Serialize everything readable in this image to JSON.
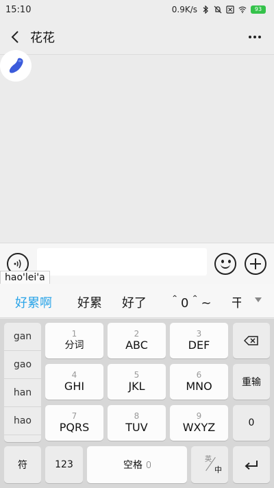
{
  "status_bar": {
    "time": "15:10",
    "network_speed": "0.9K/s",
    "battery": "93",
    "icons": [
      "bluetooth-icon",
      "mute-icon",
      "sim-icon",
      "wifi-icon",
      "battery-icon"
    ]
  },
  "nav": {
    "title": "花花",
    "back_icon": "chevron-left-icon",
    "more_icon": "more-dots-icon"
  },
  "chat": {
    "avatar_icon": "blue-shape-avatar",
    "accent_color": "#3b5bdb"
  },
  "input_bar": {
    "voice_icon": "voice-icon",
    "input_value": "",
    "emoji_icon": "emoji-icon",
    "plus_icon": "plus-icon"
  },
  "ime": {
    "composing_text": "hao'lei'a",
    "candidates": [
      "好累啊",
      "好累",
      "好了",
      "＾0＾~",
      "干"
    ],
    "highlight_color": "#2aa4e8",
    "pinyin_options": [
      "gan",
      "gao",
      "han",
      "hao"
    ],
    "keys": {
      "k1": {
        "num": "1",
        "letters": "分词"
      },
      "k2": {
        "num": "2",
        "letters": "ABC"
      },
      "k3": {
        "num": "3",
        "letters": "DEF"
      },
      "k4": {
        "num": "4",
        "letters": "GHI"
      },
      "k5": {
        "num": "5",
        "letters": "JKL"
      },
      "k6": {
        "num": "6",
        "letters": "MNO"
      },
      "k7": {
        "num": "7",
        "letters": "PQRS"
      },
      "k8": {
        "num": "8",
        "letters": "TUV"
      },
      "k9": {
        "num": "9",
        "letters": "WXYZ"
      }
    },
    "backspace_icon": "backspace-icon",
    "reinput_label": "重输",
    "zero_label": "0",
    "symbol_label": "符",
    "number_label": "123",
    "space_label": "空格",
    "lang_en": "英",
    "lang_zh": "中",
    "enter_icon": "enter-icon"
  }
}
